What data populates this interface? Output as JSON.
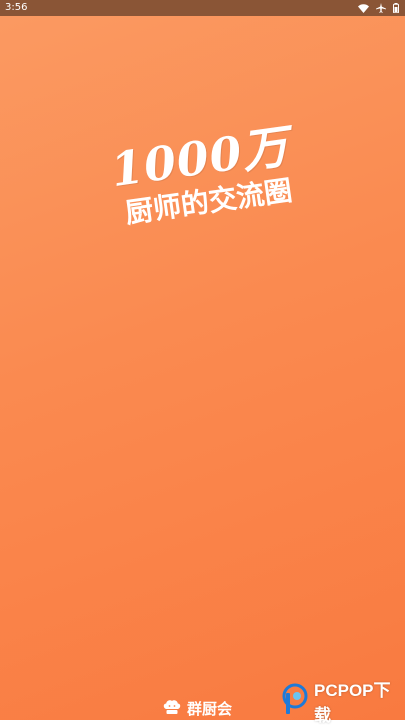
{
  "status_bar": {
    "time": "3:56",
    "icons": [
      "wifi-icon",
      "airplane-icon",
      "battery-icon"
    ]
  },
  "splash": {
    "headline": "1000万",
    "subheadline": "厨师的交流圈",
    "background_colors": [
      "#FB9A62",
      "#F97A40"
    ]
  },
  "brand": {
    "name": "群厨会",
    "logo_icon": "chef-hat-icon"
  },
  "watermark": {
    "text": "PCPOP下载",
    "logo_icon": "pcpop-logo-icon"
  }
}
